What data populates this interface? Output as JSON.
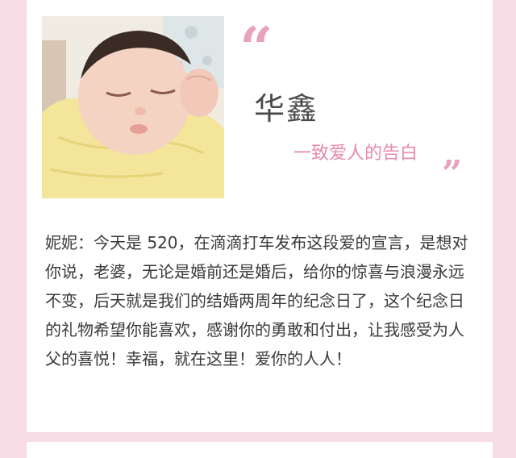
{
  "header": {
    "name": "华鑫",
    "subtitle": "一致爱人的告白",
    "quote_open": "“",
    "quote_close": "”"
  },
  "message": {
    "text": "妮妮：今天是 520，在滴滴打车发布这段爱的宣言，是想对你说，老婆，无论是婚前还是婚后，给你的惊喜与浪漫永远不变，后天就是我们的结婚两周年的纪念日了，这个纪念日的礼物希望你能喜欢，感谢你的勇敢和付出，让我感受为人父的喜悦！幸福，就在这里！爱你的人人！"
  },
  "colors": {
    "background": "#f8dce6",
    "card": "#ffffff",
    "accent_pink": "#e889aa",
    "quote_pink": "#e9a2bb",
    "text": "#3a3a3a"
  }
}
